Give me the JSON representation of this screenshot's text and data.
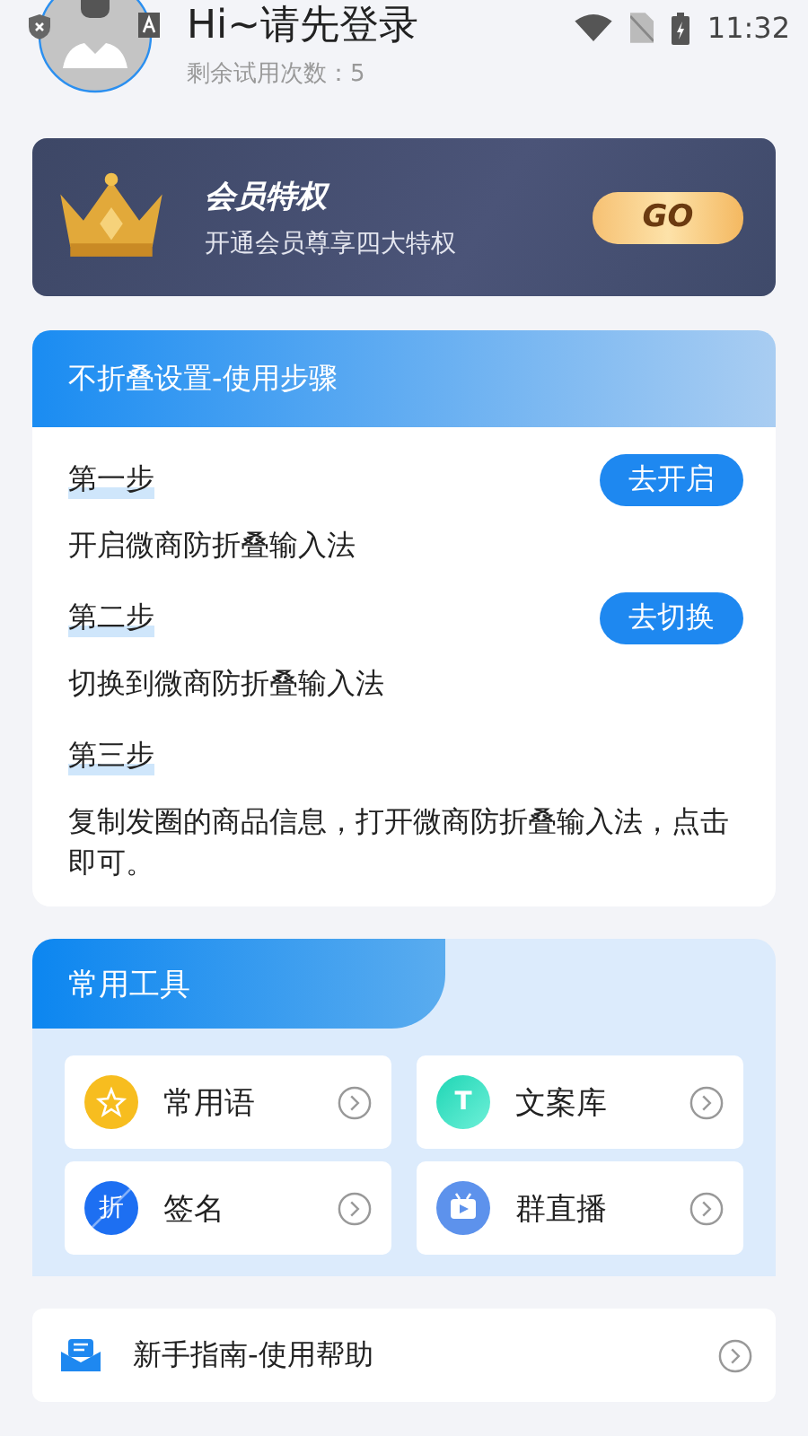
{
  "status_bar": {
    "time": "11:32"
  },
  "profile": {
    "greeting": "Hi~请先登录",
    "trials": "剩余试用次数：5"
  },
  "banner": {
    "title": "会员特权",
    "subtitle": "开通会员尊享四大特权",
    "button": "GO"
  },
  "steps_card": {
    "title": "不折叠设置-使用步骤",
    "steps": [
      {
        "label": "第一步",
        "text": "开启微商防折叠输入法",
        "action": "去开启"
      },
      {
        "label": "第二步",
        "text": "切换到微商防折叠输入法",
        "action": "去切换"
      },
      {
        "label": "第三步",
        "text": "复制发圈的商品信息，打开微商防折叠输入法，点击即可。"
      }
    ]
  },
  "tools": {
    "title": "常用工具",
    "items": [
      {
        "label": "常用语",
        "kind": "star"
      },
      {
        "label": "文案库",
        "kind": "letter",
        "glyph": "T"
      },
      {
        "label": "签名",
        "kind": "letter-slash",
        "glyph": "折"
      },
      {
        "label": "群直播",
        "kind": "tv"
      }
    ]
  },
  "help": {
    "label": "新手指南-使用帮助"
  }
}
